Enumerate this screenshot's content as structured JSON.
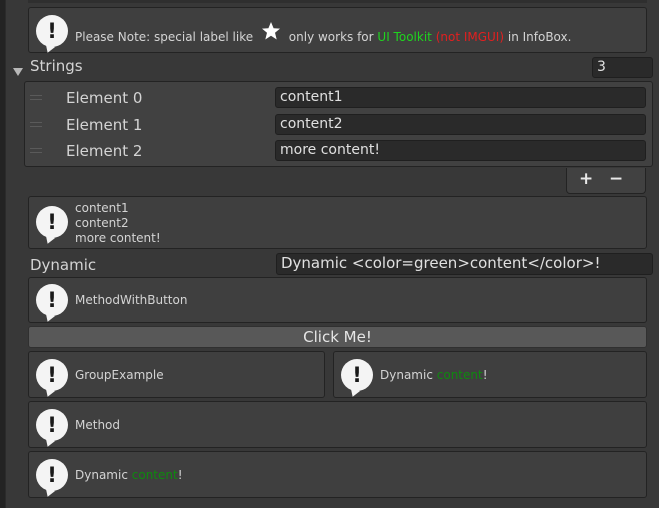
{
  "note": {
    "prefix": "Please Note: special label like",
    "middle": "only works for",
    "toolkit": "UI Toolkit",
    "imgui": "(not IMGUI)",
    "suffix": "in InfoBox."
  },
  "strings": {
    "label": "Strings",
    "size": "3",
    "elements": [
      {
        "label": "Element 0",
        "value": "content1"
      },
      {
        "label": "Element 1",
        "value": "content2"
      },
      {
        "label": "Element 2",
        "value": "more content!"
      }
    ],
    "add": "+",
    "remove": "−"
  },
  "contentBox": {
    "lines": [
      "content1",
      "content2",
      "more content!"
    ]
  },
  "dynamic": {
    "label": "Dynamic",
    "value": "Dynamic <color=green>content</color>!"
  },
  "methodWithButton": {
    "text": "MethodWithButton"
  },
  "button": {
    "label": "Click Me!"
  },
  "group": {
    "left": "GroupExample",
    "right_prefix": "Dynamic ",
    "right_colored": "content",
    "right_suffix": "!"
  },
  "method": {
    "text": "Method"
  },
  "dynamicBox": {
    "prefix": "Dynamic ",
    "colored": "content",
    "suffix": "!"
  },
  "icon": {
    "glyph": "!"
  },
  "colors": {
    "accent_green": "#1fd31f",
    "warning_red": "#e02020",
    "dynamic_green": "#0e8a0e"
  }
}
